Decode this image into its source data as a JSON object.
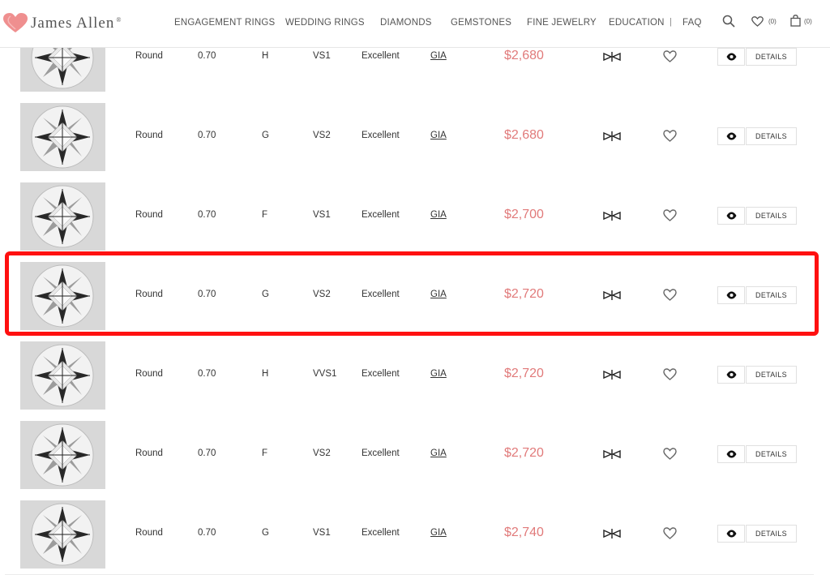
{
  "brand": {
    "name": "James Allen",
    "reg_mark": "®"
  },
  "nav": {
    "items": [
      {
        "label": "ENGAGEMENT RINGS"
      },
      {
        "label": "WEDDING RINGS"
      },
      {
        "label": "DIAMONDS"
      },
      {
        "label": "GEMSTONES"
      },
      {
        "label": "FINE JEWELRY"
      },
      {
        "label": "EDUCATION"
      }
    ],
    "separator": "|",
    "faq": "FAQ",
    "wishlist_count": "(0)",
    "cart_count": "(0)",
    "icons": [
      "search-icon",
      "heart-icon",
      "shopping-bag-icon"
    ]
  },
  "colors": {
    "price": "#e17a7a",
    "highlight": "#ff1010",
    "logo_heart": "#ef8f8f"
  },
  "results": [
    {
      "shape": "Round",
      "carat": "0.70",
      "color": "H",
      "clarity": "VS1",
      "cut": "Excellent",
      "lab": "GIA",
      "price": "$2,680",
      "details": "DETAILS"
    },
    {
      "shape": "Round",
      "carat": "0.70",
      "color": "G",
      "clarity": "VS2",
      "cut": "Excellent",
      "lab": "GIA",
      "price": "$2,680",
      "details": "DETAILS"
    },
    {
      "shape": "Round",
      "carat": "0.70",
      "color": "F",
      "clarity": "VS1",
      "cut": "Excellent",
      "lab": "GIA",
      "price": "$2,700",
      "details": "DETAILS"
    },
    {
      "shape": "Round",
      "carat": "0.70",
      "color": "G",
      "clarity": "VS2",
      "cut": "Excellent",
      "lab": "GIA",
      "price": "$2,720",
      "details": "DETAILS",
      "highlighted": true
    },
    {
      "shape": "Round",
      "carat": "0.70",
      "color": "H",
      "clarity": "VVS1",
      "cut": "Excellent",
      "lab": "GIA",
      "price": "$2,720",
      "details": "DETAILS"
    },
    {
      "shape": "Round",
      "carat": "0.70",
      "color": "F",
      "clarity": "VS2",
      "cut": "Excellent",
      "lab": "GIA",
      "price": "$2,720",
      "details": "DETAILS"
    },
    {
      "shape": "Round",
      "carat": "0.70",
      "color": "G",
      "clarity": "VS1",
      "cut": "Excellent",
      "lab": "GIA",
      "price": "$2,740",
      "details": "DETAILS"
    }
  ]
}
